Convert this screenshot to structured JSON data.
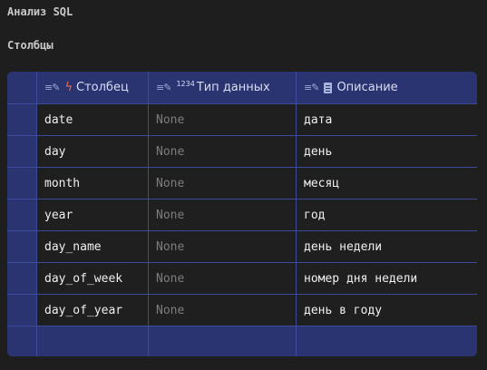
{
  "page": {
    "title": "Анализ SQL",
    "section": "Столбцы"
  },
  "table": {
    "headers": {
      "column": "Столбец",
      "type": "Тип данных",
      "type_prefix": "1234",
      "description": "Описание"
    },
    "rows": [
      {
        "column": "date",
        "type": "None",
        "description": "дата"
      },
      {
        "column": "day",
        "type": "None",
        "description": "день"
      },
      {
        "column": "month",
        "type": "None",
        "description": "месяц"
      },
      {
        "column": "year",
        "type": "None",
        "description": "год"
      },
      {
        "column": "day_name",
        "type": "None",
        "description": "день недели"
      },
      {
        "column": "day_of_week",
        "type": "None",
        "description": "номер дня недели"
      },
      {
        "column": "day_of_year",
        "type": "None",
        "description": "день в году"
      }
    ]
  },
  "icons": {
    "edit": "edit-icon",
    "bolt": "lightning-icon",
    "numbers": "numeric-type-icon",
    "document": "document-icon"
  },
  "colors": {
    "background": "#1e1e1e",
    "header": "#2a3470",
    "grid_line": "#3b4a9a",
    "accent_bolt": "#f06a4a",
    "muted_text": "#7d7d7d"
  }
}
